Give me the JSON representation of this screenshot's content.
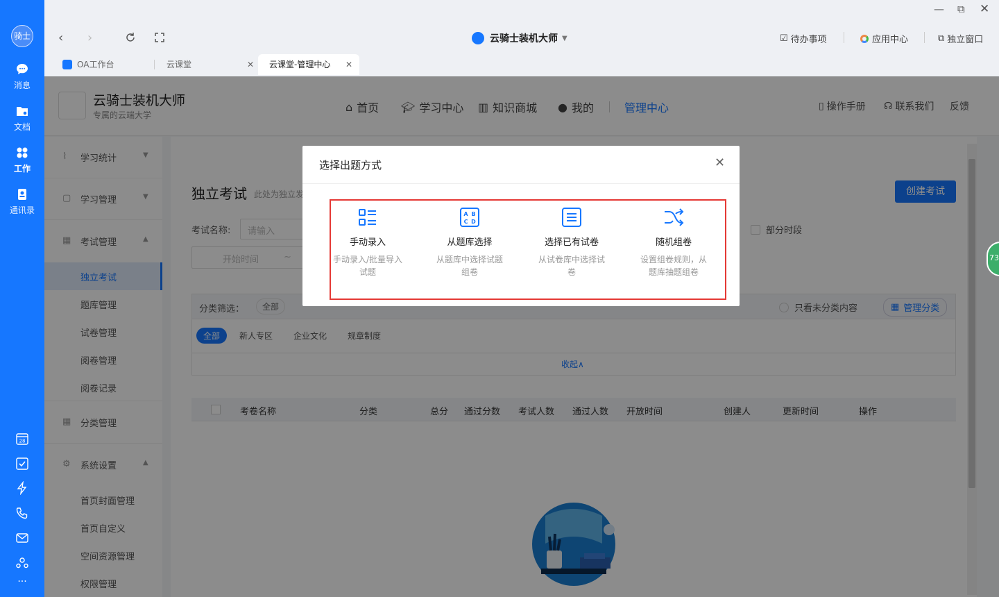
{
  "rail": {
    "avatar": "骑士",
    "items": [
      {
        "label": "消息",
        "icon": "chat-icon"
      },
      {
        "label": "文档",
        "icon": "folder-icon"
      },
      {
        "label": "工作",
        "icon": "apps-icon"
      },
      {
        "label": "通讯录",
        "icon": "contacts-icon"
      }
    ],
    "calendar_day": "28",
    "more": "···"
  },
  "titlebar": {
    "app_name": "云骑士装机大师",
    "todo": "待办事项",
    "app_center": "应用中心",
    "standalone": "独立窗口"
  },
  "tabs": [
    {
      "label": "OA工作台"
    },
    {
      "label": "云课堂"
    },
    {
      "label": "云课堂-管理中心"
    }
  ],
  "header": {
    "org_name": "云骑士装机大师",
    "org_sub": "专属的云端大学",
    "nav": [
      "首页",
      "学习中心",
      "知识商城",
      "我的",
      "管理中心"
    ],
    "manual": "操作手册",
    "contact": "联系我们",
    "feedback": "反馈"
  },
  "sidebar": {
    "groups": [
      {
        "label": "学习统计"
      },
      {
        "label": "学习管理"
      },
      {
        "label": "考试管理"
      }
    ],
    "exam_items": [
      "独立考试",
      "题库管理",
      "试卷管理",
      "阅卷管理",
      "阅卷记录"
    ],
    "category": "分类管理",
    "settings": "系统设置",
    "settings_items": [
      "首页封面管理",
      "首页自定义",
      "空间资源管理",
      "权限管理"
    ]
  },
  "content": {
    "title": "独立考试",
    "subtitle": "此处为独立发",
    "create_btn": "创建考试",
    "exam_name_label": "考试名称:",
    "exam_name_placeholder": "请输入",
    "partial_period": "部分时段",
    "start_time": "开始时间",
    "tilde": "~",
    "filter_label": "分类筛选：",
    "filter_all_chip": "全部",
    "only_uncategorized": "只看未分类内容",
    "manage_category": "管理分类",
    "categories": [
      "全部",
      "新人专区",
      "企业文化",
      "规章制度"
    ],
    "collapse": "收起∧",
    "columns": [
      "考卷名称",
      "分类",
      "总分",
      "通过分数",
      "考试人数",
      "通过人数",
      "开放时间",
      "创建人",
      "更新时间",
      "操作"
    ],
    "badge": "73"
  },
  "dialog": {
    "title": "选择出题方式",
    "options": [
      {
        "title": "手动录入",
        "desc": "手动录入/批量导入试题",
        "icon": "list-icon"
      },
      {
        "title": "从题库选择",
        "desc": "从题库中选择试题组卷",
        "icon": "abcd-icon"
      },
      {
        "title": "选择已有试卷",
        "desc": "从试卷库中选择试卷",
        "icon": "document-icon"
      },
      {
        "title": "随机组卷",
        "desc": "设置组卷规则，从题库抽题组卷",
        "icon": "shuffle-icon"
      }
    ]
  },
  "colors": {
    "accent": "#1677ff",
    "highlight": "#e53935"
  }
}
